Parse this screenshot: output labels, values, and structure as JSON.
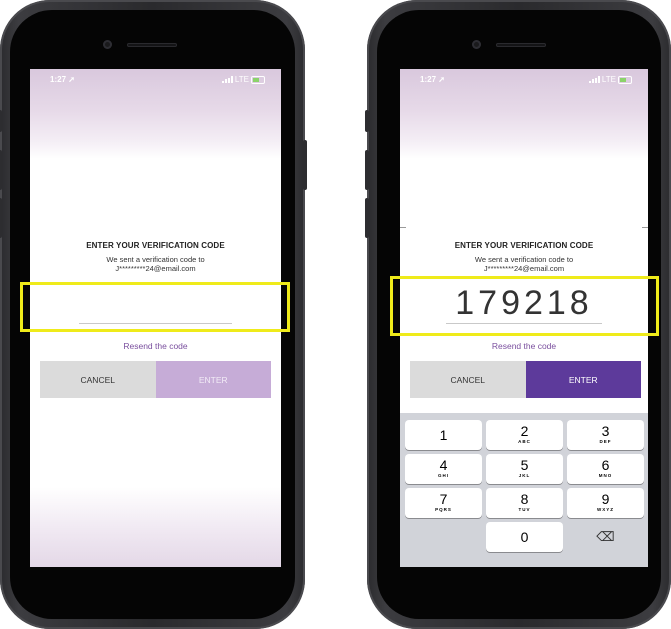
{
  "screens": [
    {
      "status": {
        "time": "1:27 ➚",
        "network": "LTE"
      },
      "card": {
        "title": "ENTER YOUR VERIFICATION CODE",
        "subtitle": "We sent a verification code to",
        "email": "J*********24@email.com",
        "code_value": ""
      },
      "resend_label": "Resend the code",
      "cancel_label": "CANCEL",
      "enter_label": "ENTER",
      "enter_state": "disabled"
    },
    {
      "status": {
        "time": "1:27 ➚",
        "network": "LTE"
      },
      "card": {
        "title": "ENTER YOUR VERIFICATION CODE",
        "subtitle": "We sent a verification code to",
        "email": "J*********24@email.com",
        "code_value": "179218"
      },
      "resend_label": "Resend the code",
      "cancel_label": "CANCEL",
      "enter_label": "ENTER",
      "enter_state": "enabled",
      "keyboard": {
        "keys": [
          {
            "num": "1",
            "letters": ""
          },
          {
            "num": "2",
            "letters": "ABC"
          },
          {
            "num": "3",
            "letters": "DEF"
          },
          {
            "num": "4",
            "letters": "GHI"
          },
          {
            "num": "5",
            "letters": "JKL"
          },
          {
            "num": "6",
            "letters": "MNO"
          },
          {
            "num": "7",
            "letters": "PQRS"
          },
          {
            "num": "8",
            "letters": "TUV"
          },
          {
            "num": "9",
            "letters": "WXYZ"
          },
          {
            "num": "0",
            "letters": ""
          }
        ],
        "delete_icon": "backspace-icon",
        "delete_glyph": "⌫"
      }
    }
  ],
  "colors": {
    "highlight": "#efeb1a",
    "enter_enabled": "#5d3a9b",
    "enter_disabled": "#c6acd7",
    "resend": "#7a4f9e"
  }
}
